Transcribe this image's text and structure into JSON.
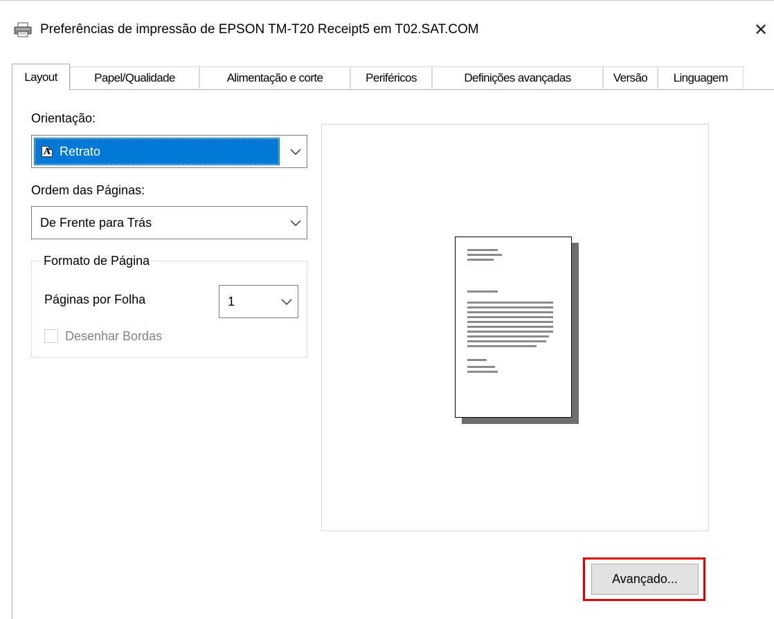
{
  "window": {
    "title": "Preferências de impressão de EPSON TM-T20 Receipt5 em T02.SAT.COM",
    "close_glyph": "✕",
    "icon": "printer-icon"
  },
  "tabs": [
    {
      "label": "Layout",
      "active": true
    },
    {
      "label": "Papel/Qualidade",
      "active": false
    },
    {
      "label": "Alimentação e corte",
      "active": false
    },
    {
      "label": "Periféricos",
      "active": false
    },
    {
      "label": "Definições avançadas",
      "active": false
    },
    {
      "label": "Versão",
      "active": false
    },
    {
      "label": "Linguagem",
      "active": false
    }
  ],
  "layout": {
    "orientation_label": "Orientação:",
    "orientation_value": "Retrato",
    "page_order_label": "Ordem das Páginas:",
    "page_order_value": "De Frente para Trás",
    "page_format": {
      "title": "Formato de Página",
      "pages_per_sheet_label": "Páginas por Folha",
      "pages_per_sheet_value": "1",
      "draw_borders_label": "Desenhar Bordas",
      "draw_borders_checked": false,
      "draw_borders_enabled": false
    },
    "advanced_button": "Avançado..."
  },
  "colors": {
    "selection": "#0078d7",
    "highlight_outline": "#e00000",
    "button_face": "#e1e1e1"
  }
}
